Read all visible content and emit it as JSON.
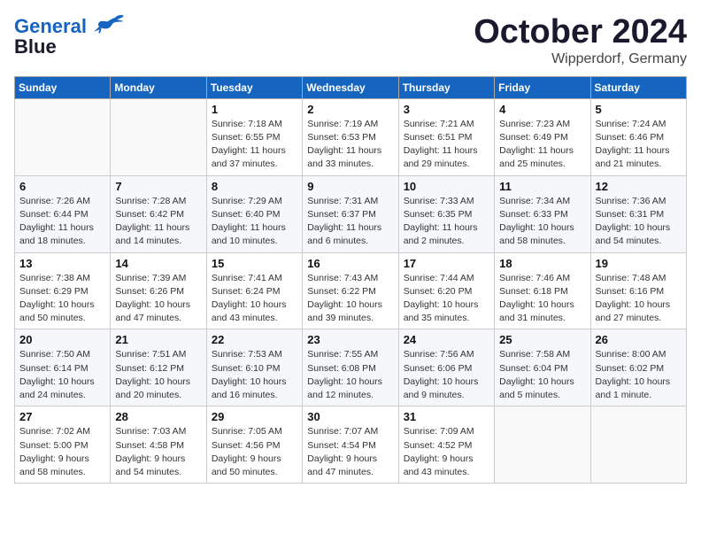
{
  "header": {
    "logo_line1": "General",
    "logo_line2": "Blue",
    "month": "October 2024",
    "location": "Wipperdorf, Germany"
  },
  "weekdays": [
    "Sunday",
    "Monday",
    "Tuesday",
    "Wednesday",
    "Thursday",
    "Friday",
    "Saturday"
  ],
  "weeks": [
    [
      {
        "day": "",
        "info": ""
      },
      {
        "day": "",
        "info": ""
      },
      {
        "day": "1",
        "info": "Sunrise: 7:18 AM\nSunset: 6:55 PM\nDaylight: 11 hours and 37 minutes."
      },
      {
        "day": "2",
        "info": "Sunrise: 7:19 AM\nSunset: 6:53 PM\nDaylight: 11 hours and 33 minutes."
      },
      {
        "day": "3",
        "info": "Sunrise: 7:21 AM\nSunset: 6:51 PM\nDaylight: 11 hours and 29 minutes."
      },
      {
        "day": "4",
        "info": "Sunrise: 7:23 AM\nSunset: 6:49 PM\nDaylight: 11 hours and 25 minutes."
      },
      {
        "day": "5",
        "info": "Sunrise: 7:24 AM\nSunset: 6:46 PM\nDaylight: 11 hours and 21 minutes."
      }
    ],
    [
      {
        "day": "6",
        "info": "Sunrise: 7:26 AM\nSunset: 6:44 PM\nDaylight: 11 hours and 18 minutes."
      },
      {
        "day": "7",
        "info": "Sunrise: 7:28 AM\nSunset: 6:42 PM\nDaylight: 11 hours and 14 minutes."
      },
      {
        "day": "8",
        "info": "Sunrise: 7:29 AM\nSunset: 6:40 PM\nDaylight: 11 hours and 10 minutes."
      },
      {
        "day": "9",
        "info": "Sunrise: 7:31 AM\nSunset: 6:37 PM\nDaylight: 11 hours and 6 minutes."
      },
      {
        "day": "10",
        "info": "Sunrise: 7:33 AM\nSunset: 6:35 PM\nDaylight: 11 hours and 2 minutes."
      },
      {
        "day": "11",
        "info": "Sunrise: 7:34 AM\nSunset: 6:33 PM\nDaylight: 10 hours and 58 minutes."
      },
      {
        "day": "12",
        "info": "Sunrise: 7:36 AM\nSunset: 6:31 PM\nDaylight: 10 hours and 54 minutes."
      }
    ],
    [
      {
        "day": "13",
        "info": "Sunrise: 7:38 AM\nSunset: 6:29 PM\nDaylight: 10 hours and 50 minutes."
      },
      {
        "day": "14",
        "info": "Sunrise: 7:39 AM\nSunset: 6:26 PM\nDaylight: 10 hours and 47 minutes."
      },
      {
        "day": "15",
        "info": "Sunrise: 7:41 AM\nSunset: 6:24 PM\nDaylight: 10 hours and 43 minutes."
      },
      {
        "day": "16",
        "info": "Sunrise: 7:43 AM\nSunset: 6:22 PM\nDaylight: 10 hours and 39 minutes."
      },
      {
        "day": "17",
        "info": "Sunrise: 7:44 AM\nSunset: 6:20 PM\nDaylight: 10 hours and 35 minutes."
      },
      {
        "day": "18",
        "info": "Sunrise: 7:46 AM\nSunset: 6:18 PM\nDaylight: 10 hours and 31 minutes."
      },
      {
        "day": "19",
        "info": "Sunrise: 7:48 AM\nSunset: 6:16 PM\nDaylight: 10 hours and 27 minutes."
      }
    ],
    [
      {
        "day": "20",
        "info": "Sunrise: 7:50 AM\nSunset: 6:14 PM\nDaylight: 10 hours and 24 minutes."
      },
      {
        "day": "21",
        "info": "Sunrise: 7:51 AM\nSunset: 6:12 PM\nDaylight: 10 hours and 20 minutes."
      },
      {
        "day": "22",
        "info": "Sunrise: 7:53 AM\nSunset: 6:10 PM\nDaylight: 10 hours and 16 minutes."
      },
      {
        "day": "23",
        "info": "Sunrise: 7:55 AM\nSunset: 6:08 PM\nDaylight: 10 hours and 12 minutes."
      },
      {
        "day": "24",
        "info": "Sunrise: 7:56 AM\nSunset: 6:06 PM\nDaylight: 10 hours and 9 minutes."
      },
      {
        "day": "25",
        "info": "Sunrise: 7:58 AM\nSunset: 6:04 PM\nDaylight: 10 hours and 5 minutes."
      },
      {
        "day": "26",
        "info": "Sunrise: 8:00 AM\nSunset: 6:02 PM\nDaylight: 10 hours and 1 minute."
      }
    ],
    [
      {
        "day": "27",
        "info": "Sunrise: 7:02 AM\nSunset: 5:00 PM\nDaylight: 9 hours and 58 minutes."
      },
      {
        "day": "28",
        "info": "Sunrise: 7:03 AM\nSunset: 4:58 PM\nDaylight: 9 hours and 54 minutes."
      },
      {
        "day": "29",
        "info": "Sunrise: 7:05 AM\nSunset: 4:56 PM\nDaylight: 9 hours and 50 minutes."
      },
      {
        "day": "30",
        "info": "Sunrise: 7:07 AM\nSunset: 4:54 PM\nDaylight: 9 hours and 47 minutes."
      },
      {
        "day": "31",
        "info": "Sunrise: 7:09 AM\nSunset: 4:52 PM\nDaylight: 9 hours and 43 minutes."
      },
      {
        "day": "",
        "info": ""
      },
      {
        "day": "",
        "info": ""
      }
    ]
  ]
}
